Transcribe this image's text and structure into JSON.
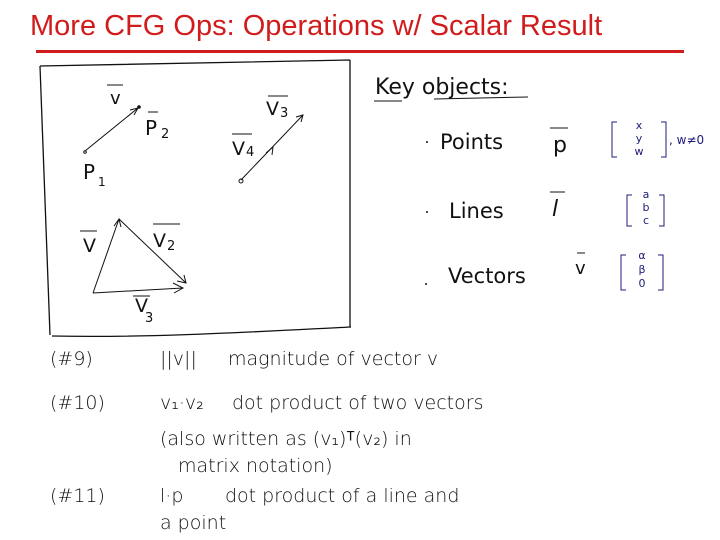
{
  "slide": {
    "title": "More CFG Ops: Operations w/ Scalar Result",
    "colors": {
      "title": "#d01c1c",
      "ink": "#111111",
      "blue_ink": "#1c1c7a"
    }
  },
  "diagram": {
    "labels": {
      "v_top": "v",
      "p2": "P",
      "p2_sub": "2",
      "p1": "P",
      "p1_sub": "1",
      "v3": "V",
      "v3_sub": "3",
      "v4": "V",
      "v4_sub": "4",
      "v": "V",
      "v2": "V",
      "v2_sub": "2",
      "v3b": "V",
      "v3b_sub": "3"
    }
  },
  "key_objects": {
    "heading": "Key objects:",
    "items": [
      {
        "name": "Points",
        "symbol": "p",
        "vector": [
          "x",
          "y",
          "w"
        ],
        "condition": ", w≠0"
      },
      {
        "name": "Lines",
        "symbol": "l",
        "vector": [
          "a",
          "b",
          "c"
        ],
        "condition": ""
      },
      {
        "name": "Vectors",
        "symbol": "v",
        "vector": [
          "α",
          "β",
          "0"
        ],
        "condition": ""
      }
    ]
  },
  "operations": [
    {
      "number": "(#9)",
      "expr": "||v||",
      "desc": "magnitude of vector v"
    },
    {
      "number": "(#10)",
      "expr": "v₁·v₂",
      "desc": "dot product of two vectors",
      "extra_line1": "(also written as (v₁)ᵀ(v₂) in",
      "extra_line2": "matrix notation)"
    },
    {
      "number": "(#11)",
      "expr": "l·p",
      "desc": "dot product of a line and",
      "extra_line1": "a point"
    }
  ]
}
